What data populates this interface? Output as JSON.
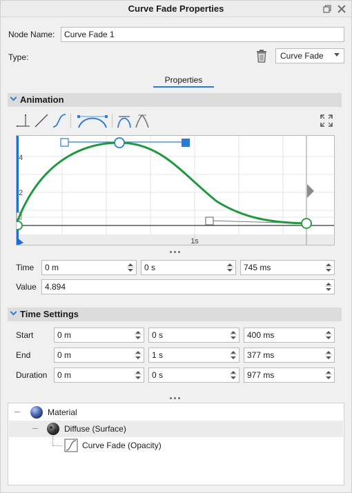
{
  "window": {
    "title": "Curve Fade Properties"
  },
  "node": {
    "name_label": "Node Name:",
    "name_value": "Curve Fade 1",
    "type_label": "Type:",
    "type_value": "Curve Fade"
  },
  "tabs": [
    {
      "label": "Properties",
      "active": true
    }
  ],
  "animation": {
    "section_title": "Animation",
    "tool_icons": [
      "step-icon",
      "linear-icon",
      "s-curve-icon",
      "ease-in-out-icon",
      "bezier-smooth-icon",
      "bezier-corner-icon",
      "fit-view-icon"
    ],
    "graph": {
      "y_ticks": [
        "4",
        "2"
      ],
      "x_ticks": [
        "1s"
      ],
      "curve_color": "#1e9a3c",
      "handle_color": "#2b7bd6"
    },
    "time_label": "Time",
    "time": {
      "minutes": "0 m",
      "seconds": "0 s",
      "milliseconds": "745 ms"
    },
    "value_label": "Value",
    "value": "4.894"
  },
  "time_settings": {
    "section_title": "Time Settings",
    "rows": [
      {
        "label": "Start",
        "minutes": "0 m",
        "seconds": "0 s",
        "milliseconds": "400 ms"
      },
      {
        "label": "End",
        "minutes": "0 m",
        "seconds": "1 s",
        "milliseconds": "377 ms"
      },
      {
        "label": "Duration",
        "minutes": "0 m",
        "seconds": "0 s",
        "milliseconds": "977 ms"
      }
    ]
  },
  "tree": {
    "items": [
      {
        "label": "Material",
        "icon": "material-sphere-icon"
      },
      {
        "label": "Diffuse (Surface)",
        "icon": "diffuse-sphere-icon",
        "selected": true
      },
      {
        "label": "Curve Fade (Opacity)",
        "icon": "curve-fade-icon"
      }
    ]
  }
}
